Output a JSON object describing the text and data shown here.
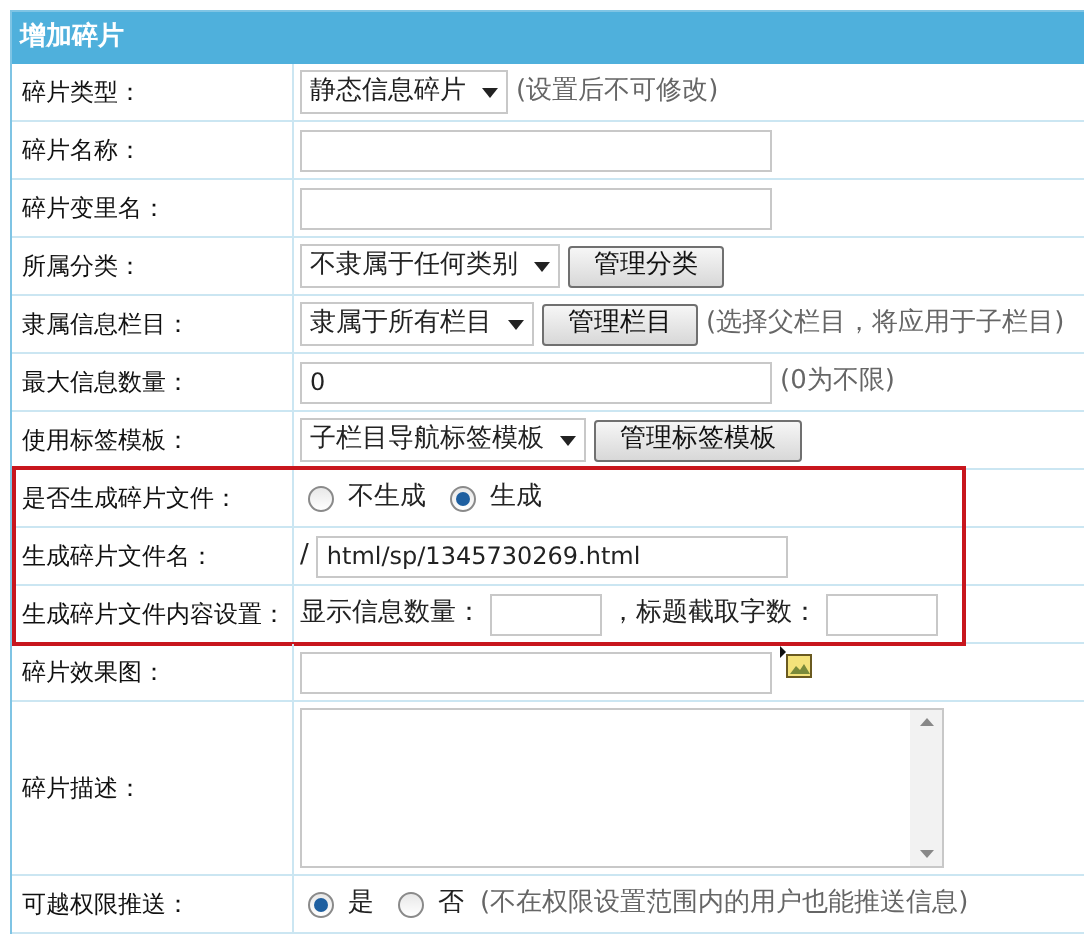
{
  "title": "增加碎片",
  "rows": [
    {
      "label": "碎片类型：",
      "highlighted": false,
      "controls": [
        {
          "kind": "select",
          "value": "静态信息碎片"
        },
        {
          "kind": "note",
          "text": "(设置后不可修改)"
        }
      ]
    },
    {
      "label": "碎片名称：",
      "highlighted": false,
      "controls": [
        {
          "kind": "input"
        }
      ]
    },
    {
      "label": "碎片变里名：",
      "highlighted": false,
      "controls": [
        {
          "kind": "input"
        }
      ]
    },
    {
      "label": "所属分类：",
      "highlighted": false,
      "controls": [
        {
          "kind": "select",
          "value": "不隶属于任何类别"
        },
        {
          "kind": "button",
          "label": "管理分类"
        }
      ]
    },
    {
      "label": "隶属信息栏目：",
      "highlighted": false,
      "controls": [
        {
          "kind": "select",
          "value": "隶属于所有栏目"
        },
        {
          "kind": "button",
          "label": "管理栏目"
        },
        {
          "kind": "note",
          "text": "(选择父栏目，将应用于子栏目)"
        }
      ]
    },
    {
      "label": "最大信息数量：",
      "highlighted": false,
      "controls": [
        {
          "kind": "input",
          "value": "0"
        },
        {
          "kind": "note",
          "text": "(0为不限)"
        }
      ]
    },
    {
      "label": "使用标签模板：",
      "highlighted": false,
      "controls": [
        {
          "kind": "select",
          "value": "子栏目导航标签模板"
        },
        {
          "kind": "button",
          "label": "管理标签模板"
        }
      ]
    },
    {
      "label": "是否生成碎片文件：",
      "highlighted": true,
      "controls": [
        {
          "kind": "radio",
          "label": "不生成",
          "selected": false
        },
        {
          "kind": "radio",
          "label": "生成",
          "selected": true
        }
      ]
    },
    {
      "label": "生成碎片文件名：",
      "highlighted": true,
      "controls": [
        {
          "kind": "text",
          "text": "/"
        },
        {
          "kind": "input",
          "value": "html/sp/1345730269.html"
        }
      ]
    },
    {
      "label": "生成碎片文件内容设置：",
      "highlighted": true,
      "controls": [
        {
          "kind": "text",
          "text": "显示信息数量："
        },
        {
          "kind": "small_input"
        },
        {
          "kind": "text",
          "text": "，标题截取字数："
        },
        {
          "kind": "small_input"
        }
      ]
    },
    {
      "label": "碎片效果图：",
      "highlighted": false,
      "controls": [
        {
          "kind": "input"
        },
        {
          "kind": "image_picker"
        }
      ]
    },
    {
      "label": "碎片描述：",
      "highlighted": false,
      "controls": [
        {
          "kind": "textarea"
        }
      ]
    },
    {
      "label": "可越权限推送：",
      "highlighted": false,
      "controls": [
        {
          "kind": "radio",
          "label": "是",
          "selected": true
        },
        {
          "kind": "radio",
          "label": "否",
          "selected": false
        },
        {
          "kind": "note",
          "text": "(不在权限设置范围内的用户也能推送信息)"
        }
      ]
    }
  ]
}
